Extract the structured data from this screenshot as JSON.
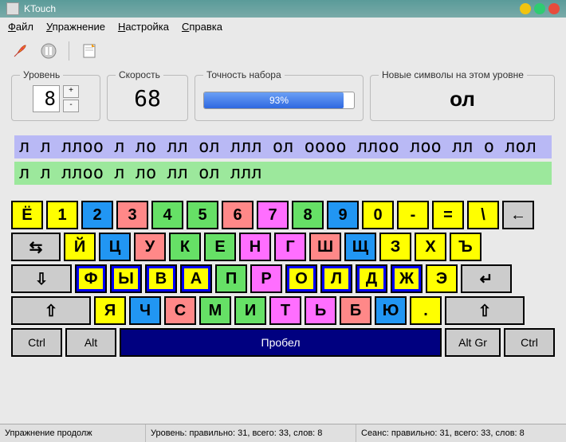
{
  "window": {
    "title": "KTouch"
  },
  "menu": {
    "file_u": "Ф",
    "file_r": "айл",
    "exercise_u": "У",
    "exercise_r": "пражнение",
    "settings_u": "Н",
    "settings_r": "астройка",
    "help_u": "С",
    "help_r": "правка"
  },
  "stats": {
    "level_label": "Уровень",
    "level_value": "8",
    "speed_label": "Скорость",
    "speed_value": "68",
    "accuracy_label": "Точность набора",
    "accuracy_text": "93%",
    "accuracy_percent": 93,
    "newchars_label": "Новые символы на этом уровне",
    "newchars_value": "ол"
  },
  "lesson": {
    "target": "л л ллоо л ло лл ол ллл ол оооо ллоо лоо лл о лол",
    "typed": "л л ллоо л ло лл ол ллл"
  },
  "keyboard": {
    "row1": [
      {
        "l": "Ё",
        "c": "yellow",
        "n": "key-yo"
      },
      {
        "l": "1",
        "c": "yellow",
        "n": "key-1"
      },
      {
        "l": "2",
        "c": "blue",
        "n": "key-2"
      },
      {
        "l": "3",
        "c": "pink",
        "n": "key-3"
      },
      {
        "l": "4",
        "c": "green",
        "n": "key-4"
      },
      {
        "l": "5",
        "c": "green",
        "n": "key-5"
      },
      {
        "l": "6",
        "c": "pink",
        "n": "key-6"
      },
      {
        "l": "7",
        "c": "magenta",
        "n": "key-7"
      },
      {
        "l": "8",
        "c": "green",
        "n": "key-8"
      },
      {
        "l": "9",
        "c": "blue",
        "n": "key-9"
      },
      {
        "l": "0",
        "c": "yellow",
        "n": "key-0"
      },
      {
        "l": "-",
        "c": "yellow",
        "n": "key-minus"
      },
      {
        "l": "=",
        "c": "yellow",
        "n": "key-equals"
      },
      {
        "l": "\\",
        "c": "yellow",
        "n": "key-backslash"
      },
      {
        "l": "←",
        "c": "gray",
        "n": "key-backspace",
        "w": "k1"
      }
    ],
    "row2": [
      {
        "l": "⇆",
        "c": "gray",
        "n": "key-tab",
        "w": "k15"
      },
      {
        "l": "Й",
        "c": "yellow",
        "n": "key-й"
      },
      {
        "l": "Ц",
        "c": "blue",
        "n": "key-ц"
      },
      {
        "l": "У",
        "c": "pink",
        "n": "key-у"
      },
      {
        "l": "К",
        "c": "green",
        "n": "key-к"
      },
      {
        "l": "Е",
        "c": "green",
        "n": "key-е"
      },
      {
        "l": "Н",
        "c": "magenta",
        "n": "key-н"
      },
      {
        "l": "Г",
        "c": "magenta",
        "n": "key-г"
      },
      {
        "l": "Ш",
        "c": "pink",
        "n": "key-ш"
      },
      {
        "l": "Щ",
        "c": "blue",
        "n": "key-щ"
      },
      {
        "l": "З",
        "c": "yellow",
        "n": "key-з"
      },
      {
        "l": "Х",
        "c": "yellow",
        "n": "key-х"
      },
      {
        "l": "Ъ",
        "c": "yellow",
        "n": "key-ъ"
      }
    ],
    "row3": [
      {
        "l": "⇩",
        "c": "gray",
        "n": "key-capslock",
        "w": "k175"
      },
      {
        "l": "Ф",
        "c": "yellow",
        "n": "key-ф",
        "hl": true
      },
      {
        "l": "Ы",
        "c": "blue",
        "n": "key-ы",
        "hl": true
      },
      {
        "l": "В",
        "c": "pink",
        "n": "key-в",
        "hl": true
      },
      {
        "l": "А",
        "c": "green",
        "n": "key-а",
        "hl": true
      },
      {
        "l": "П",
        "c": "green",
        "n": "key-п"
      },
      {
        "l": "Р",
        "c": "magenta",
        "n": "key-р"
      },
      {
        "l": "О",
        "c": "magenta",
        "n": "key-о",
        "hl": true
      },
      {
        "l": "Л",
        "c": "pink",
        "n": "key-л",
        "hl": true
      },
      {
        "l": "Д",
        "c": "blue",
        "n": "key-д",
        "hl": true
      },
      {
        "l": "Ж",
        "c": "yellow",
        "n": "key-ж",
        "hl": true
      },
      {
        "l": "Э",
        "c": "yellow",
        "n": "key-э"
      },
      {
        "l": "↵",
        "c": "gray",
        "n": "key-enter",
        "w": "kenter"
      }
    ],
    "row4": [
      {
        "l": "⇧",
        "c": "gray",
        "n": "key-lshift",
        "w": "k225"
      },
      {
        "l": "Я",
        "c": "yellow",
        "n": "key-я"
      },
      {
        "l": "Ч",
        "c": "blue",
        "n": "key-ч"
      },
      {
        "l": "С",
        "c": "pink",
        "n": "key-с"
      },
      {
        "l": "М",
        "c": "green",
        "n": "key-м"
      },
      {
        "l": "И",
        "c": "green",
        "n": "key-и"
      },
      {
        "l": "Т",
        "c": "magenta",
        "n": "key-т"
      },
      {
        "l": "Ь",
        "c": "magenta",
        "n": "key-ь"
      },
      {
        "l": "Б",
        "c": "pink",
        "n": "key-б"
      },
      {
        "l": "Ю",
        "c": "blue",
        "n": "key-ю"
      },
      {
        "l": ".",
        "c": "yellow",
        "n": "key-period"
      },
      {
        "l": "⇧",
        "c": "gray",
        "n": "key-rshift",
        "w": "k225"
      }
    ],
    "row5": [
      {
        "l": "Ctrl",
        "c": "gray",
        "n": "key-lctrl",
        "w": "kctrl"
      },
      {
        "l": "Alt",
        "c": "gray",
        "n": "key-lalt",
        "w": "kctrl"
      },
      {
        "l": "Пробел",
        "c": "space",
        "n": "key-space",
        "w": "kspace"
      },
      {
        "l": "Alt Gr",
        "c": "gray",
        "n": "key-altgr",
        "w": "kaltgr"
      },
      {
        "l": "Ctrl",
        "c": "gray",
        "n": "key-rctrl",
        "w": "kctrl"
      }
    ]
  },
  "status": {
    "exercise": "Упражнение продолж",
    "level": "Уровень: правильно: 31, всего: 33, слов: 8",
    "session": "Сеанс: правильно: 31, всего: 33, слов: 8"
  }
}
